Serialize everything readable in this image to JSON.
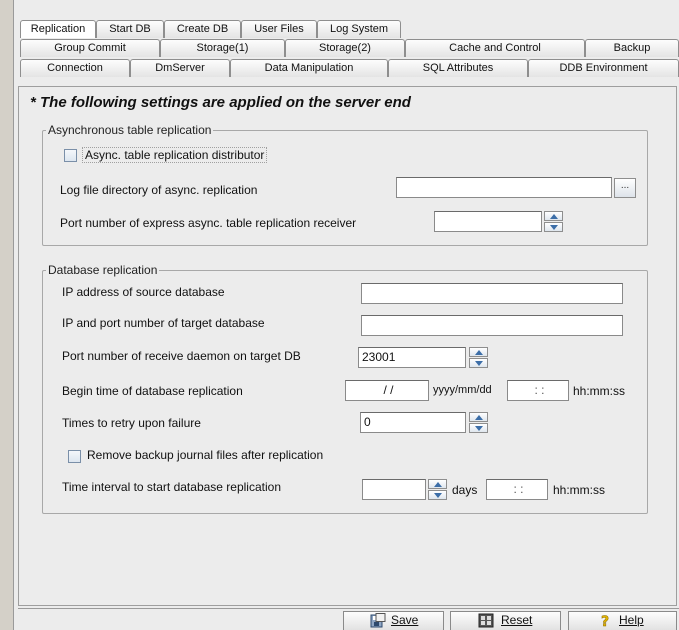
{
  "tabs": {
    "row1": [
      "Replication",
      "Start DB",
      "Create DB",
      "User Files",
      "Log System"
    ],
    "row2": [
      "Group Commit",
      "Storage(1)",
      "Storage(2)",
      "Cache and Control",
      "Backup"
    ],
    "row3": [
      "Connection",
      "DmServer",
      "Data Manipulation",
      "SQL Attributes",
      "DDB Environment"
    ]
  },
  "heading": "* The following settings are applied on the server end",
  "async_group": {
    "legend": "Asynchronous table replication",
    "distributor_label": "Async. table replication distributor",
    "log_dir_label": "Log file directory of async. replication",
    "log_dir_value": "",
    "browse_label": "...",
    "port_label": "Port number of express async. table replication receiver",
    "port_value": ""
  },
  "db_group": {
    "legend": "Database replication",
    "source_ip_label": "IP address of source database",
    "source_ip_value": "",
    "target_ip_label": "IP and port number of target database",
    "target_ip_value": "",
    "daemon_port_label": "Port number of receive daemon on target DB",
    "daemon_port_value": "23001",
    "begin_time_label": "Begin time of database replication",
    "begin_date_value": "  /  /",
    "date_format": "yyyy/mm/dd",
    "begin_time_value": " :  :",
    "time_format": "hh:mm:ss",
    "retry_label": "Times to retry upon failure",
    "retry_value": "0",
    "remove_backup_label": "Remove backup journal files after replication",
    "interval_label": "Time interval to start database replication",
    "interval_days_value": "",
    "days_unit": "days",
    "interval_time_value": " :  :",
    "interval_time_format": "hh:mm:ss"
  },
  "buttons": {
    "save": "Save",
    "reset": "Reset",
    "help": "Help"
  }
}
